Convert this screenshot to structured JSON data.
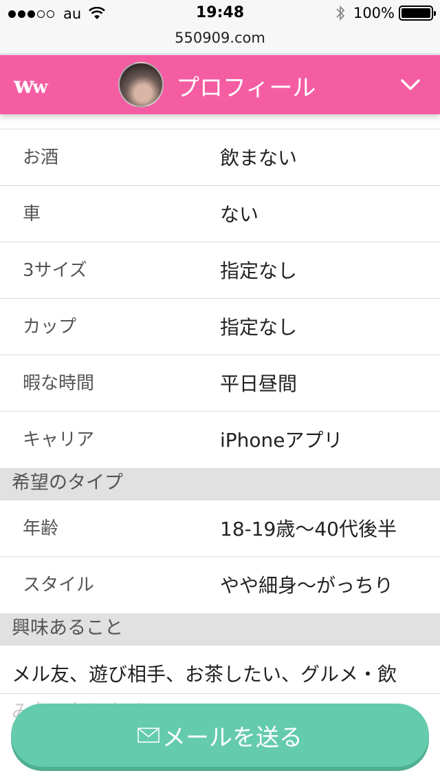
{
  "status_bar": {
    "carrier": "au",
    "time": "19:48",
    "battery": "100%"
  },
  "url": "550909.com",
  "header": {
    "logo": "ww",
    "title": "プロフィール"
  },
  "profile_rows": [
    {
      "label": "お酒",
      "value": "飲まない"
    },
    {
      "label": "車",
      "value": "ない"
    },
    {
      "label": "3サイズ",
      "value": "指定なし"
    },
    {
      "label": "カップ",
      "value": "指定なし"
    },
    {
      "label": "暇な時間",
      "value": "平日昼間"
    },
    {
      "label": "キャリア",
      "value": "iPhoneアプリ"
    }
  ],
  "preferred_type": {
    "heading": "希望のタイプ",
    "rows": [
      {
        "label": "年齢",
        "value": "18-19歳〜40代後半"
      },
      {
        "label": "スタイル",
        "value": "やや細身〜がっちり"
      }
    ]
  },
  "interests": {
    "heading": "興味あること",
    "line1": "メル友、遊び相手、お茶したい、グルメ・飲",
    "line2": "み友、何となく"
  },
  "send_button": {
    "label": "メールを送る",
    "icon": "mail-icon"
  },
  "colors": {
    "header": "#f55da3",
    "button": "#65cbad",
    "section_bg": "#e1e1e1"
  }
}
